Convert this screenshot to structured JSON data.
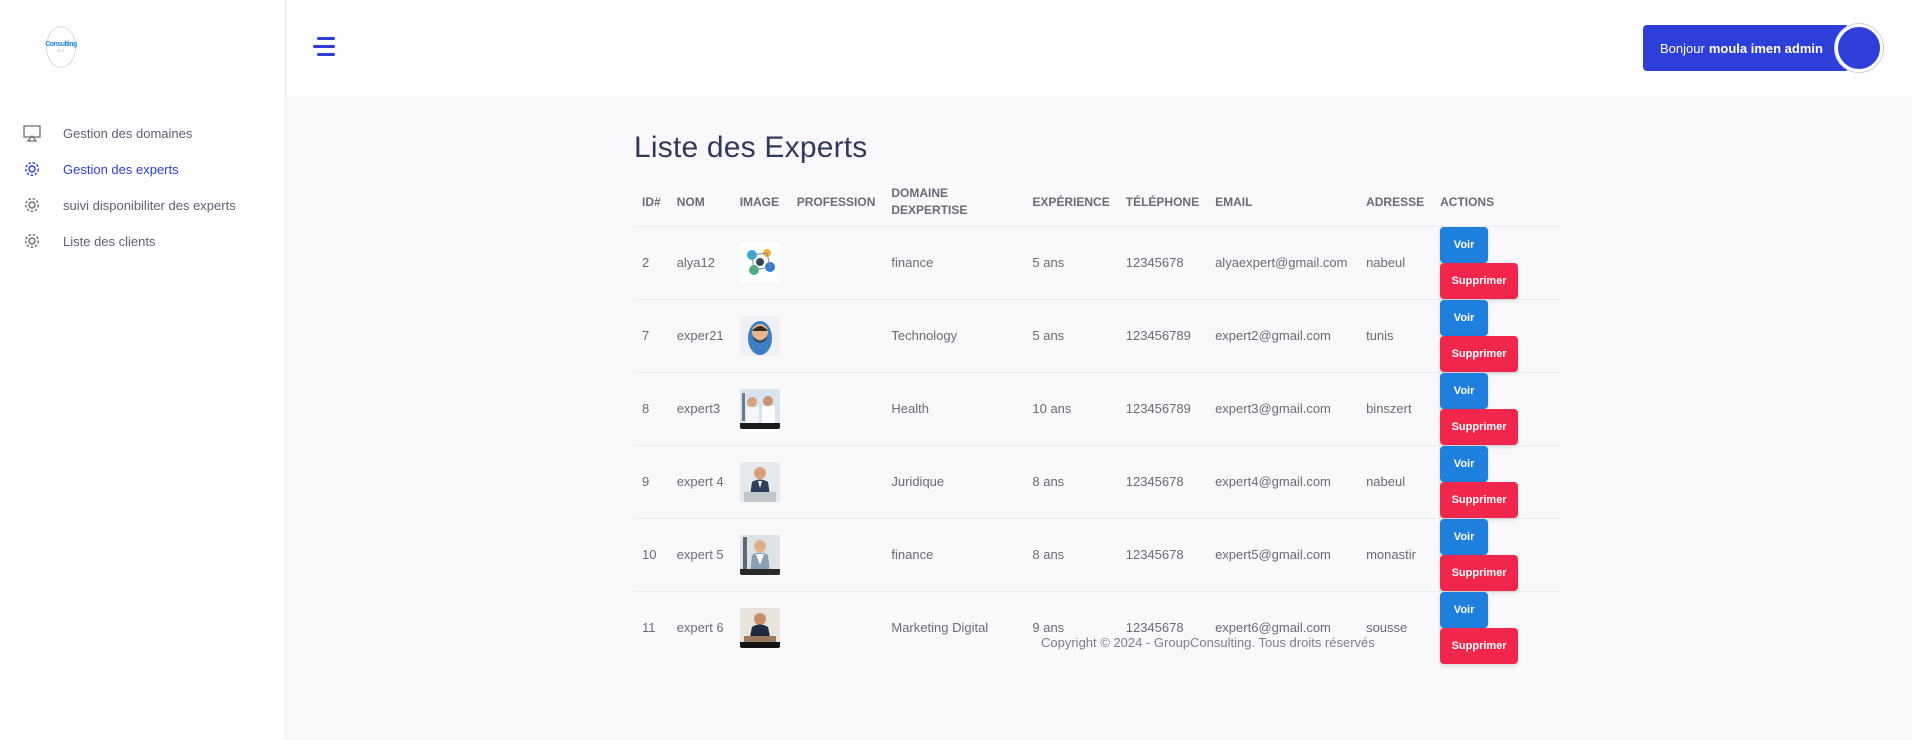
{
  "logo": {
    "text": "Consulting",
    "subtext": "G C"
  },
  "sidebar": {
    "items": [
      {
        "label": "Gestion des domaines",
        "icon": "monitor-icon",
        "active": false
      },
      {
        "label": "Gestion des experts",
        "icon": "gear-icon",
        "active": true
      },
      {
        "label": "suivi disponibiliter des experts",
        "icon": "gear-icon",
        "active": false
      },
      {
        "label": "Liste des clients",
        "icon": "gear-icon",
        "active": false
      }
    ]
  },
  "header": {
    "menu_icon": "hamburger-menu-icon",
    "greeting": "Bonjour",
    "user_name": "moula imen admin"
  },
  "main": {
    "title": "Liste des Experts",
    "columns": {
      "id": "ID#",
      "nom": "NOM",
      "image": "IMAGE",
      "profession": "PROFESSION",
      "domaine_line1": "DOMAINE",
      "domaine_line2": "DEXPERTISE",
      "experience": "EXPÉRIENCE",
      "telephone": "TÉLÉPHONE",
      "email": "EMAIL",
      "adresse": "ADRESSE",
      "actions": "ACTIONS"
    },
    "rows": [
      {
        "id": "2",
        "nom": "alya12",
        "profession": "",
        "domaine": "finance",
        "experience": "5 ans",
        "telephone": "12345678",
        "email": "alyaexpert@gmail.com",
        "adresse": "nabeul"
      },
      {
        "id": "7",
        "nom": "exper21",
        "profession": "",
        "domaine": "Technology",
        "experience": "5 ans",
        "telephone": "123456789",
        "email": "expert2@gmail.com",
        "adresse": "tunis"
      },
      {
        "id": "8",
        "nom": "expert3",
        "profession": "",
        "domaine": "Health",
        "experience": "10 ans",
        "telephone": "123456789",
        "email": "expert3@gmail.com",
        "adresse": "binszert"
      },
      {
        "id": "9",
        "nom": "expert 4",
        "profession": "",
        "domaine": "Juridique",
        "experience": "8 ans",
        "telephone": "12345678",
        "email": "expert4@gmail.com",
        "adresse": "nabeul"
      },
      {
        "id": "10",
        "nom": "expert 5",
        "profession": "",
        "domaine": "finance",
        "experience": "8 ans",
        "telephone": "12345678",
        "email": "expert5@gmail.com",
        "adresse": "monastir"
      },
      {
        "id": "11",
        "nom": "expert 6",
        "profession": "",
        "domaine": "Marketing Digital",
        "experience": "9 ans",
        "telephone": "12345678",
        "email": "expert6@gmail.com",
        "adresse": "sousse"
      }
    ],
    "actions": {
      "view_label": "Voir",
      "delete_label": "Supprimer"
    }
  },
  "footer": {
    "text": "Copyright © 2024 - GroupConsulting. Tous droits réservés"
  },
  "colors": {
    "accent": "#2e3fd9",
    "view": "#1e7fdc",
    "delete": "#f0264d",
    "title": "#32395a"
  }
}
